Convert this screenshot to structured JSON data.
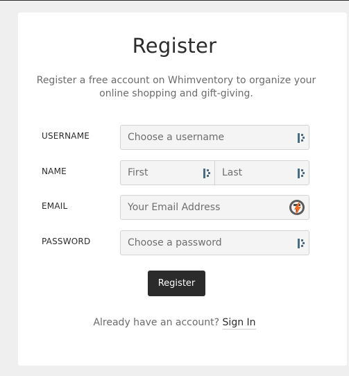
{
  "page": {
    "title": "Register",
    "subtitle": "Register a free account on Whimventory to organize your online shopping and gift-giving."
  },
  "form": {
    "username": {
      "label": "USERNAME",
      "placeholder": "Choose a username",
      "value": ""
    },
    "name": {
      "label": "NAME",
      "first": {
        "placeholder": "First",
        "value": ""
      },
      "last": {
        "placeholder": "Last",
        "value": ""
      }
    },
    "email": {
      "label": "EMAIL",
      "placeholder": "Your Email Address",
      "value": ""
    },
    "password": {
      "label": "PASSWORD",
      "placeholder": "Choose a password",
      "value": ""
    },
    "submit_label": "Register"
  },
  "footer": {
    "prompt": "Already have an account?",
    "signin_link": "Sign In"
  },
  "icons": {
    "password_manager": "password-manager-icon",
    "extension": "extension-icon"
  },
  "colors": {
    "background": "#efefef",
    "card": "#ffffff",
    "button": "#2b2b2b",
    "input_bg": "#f4f4f4",
    "input_border": "#d3d3d3"
  }
}
